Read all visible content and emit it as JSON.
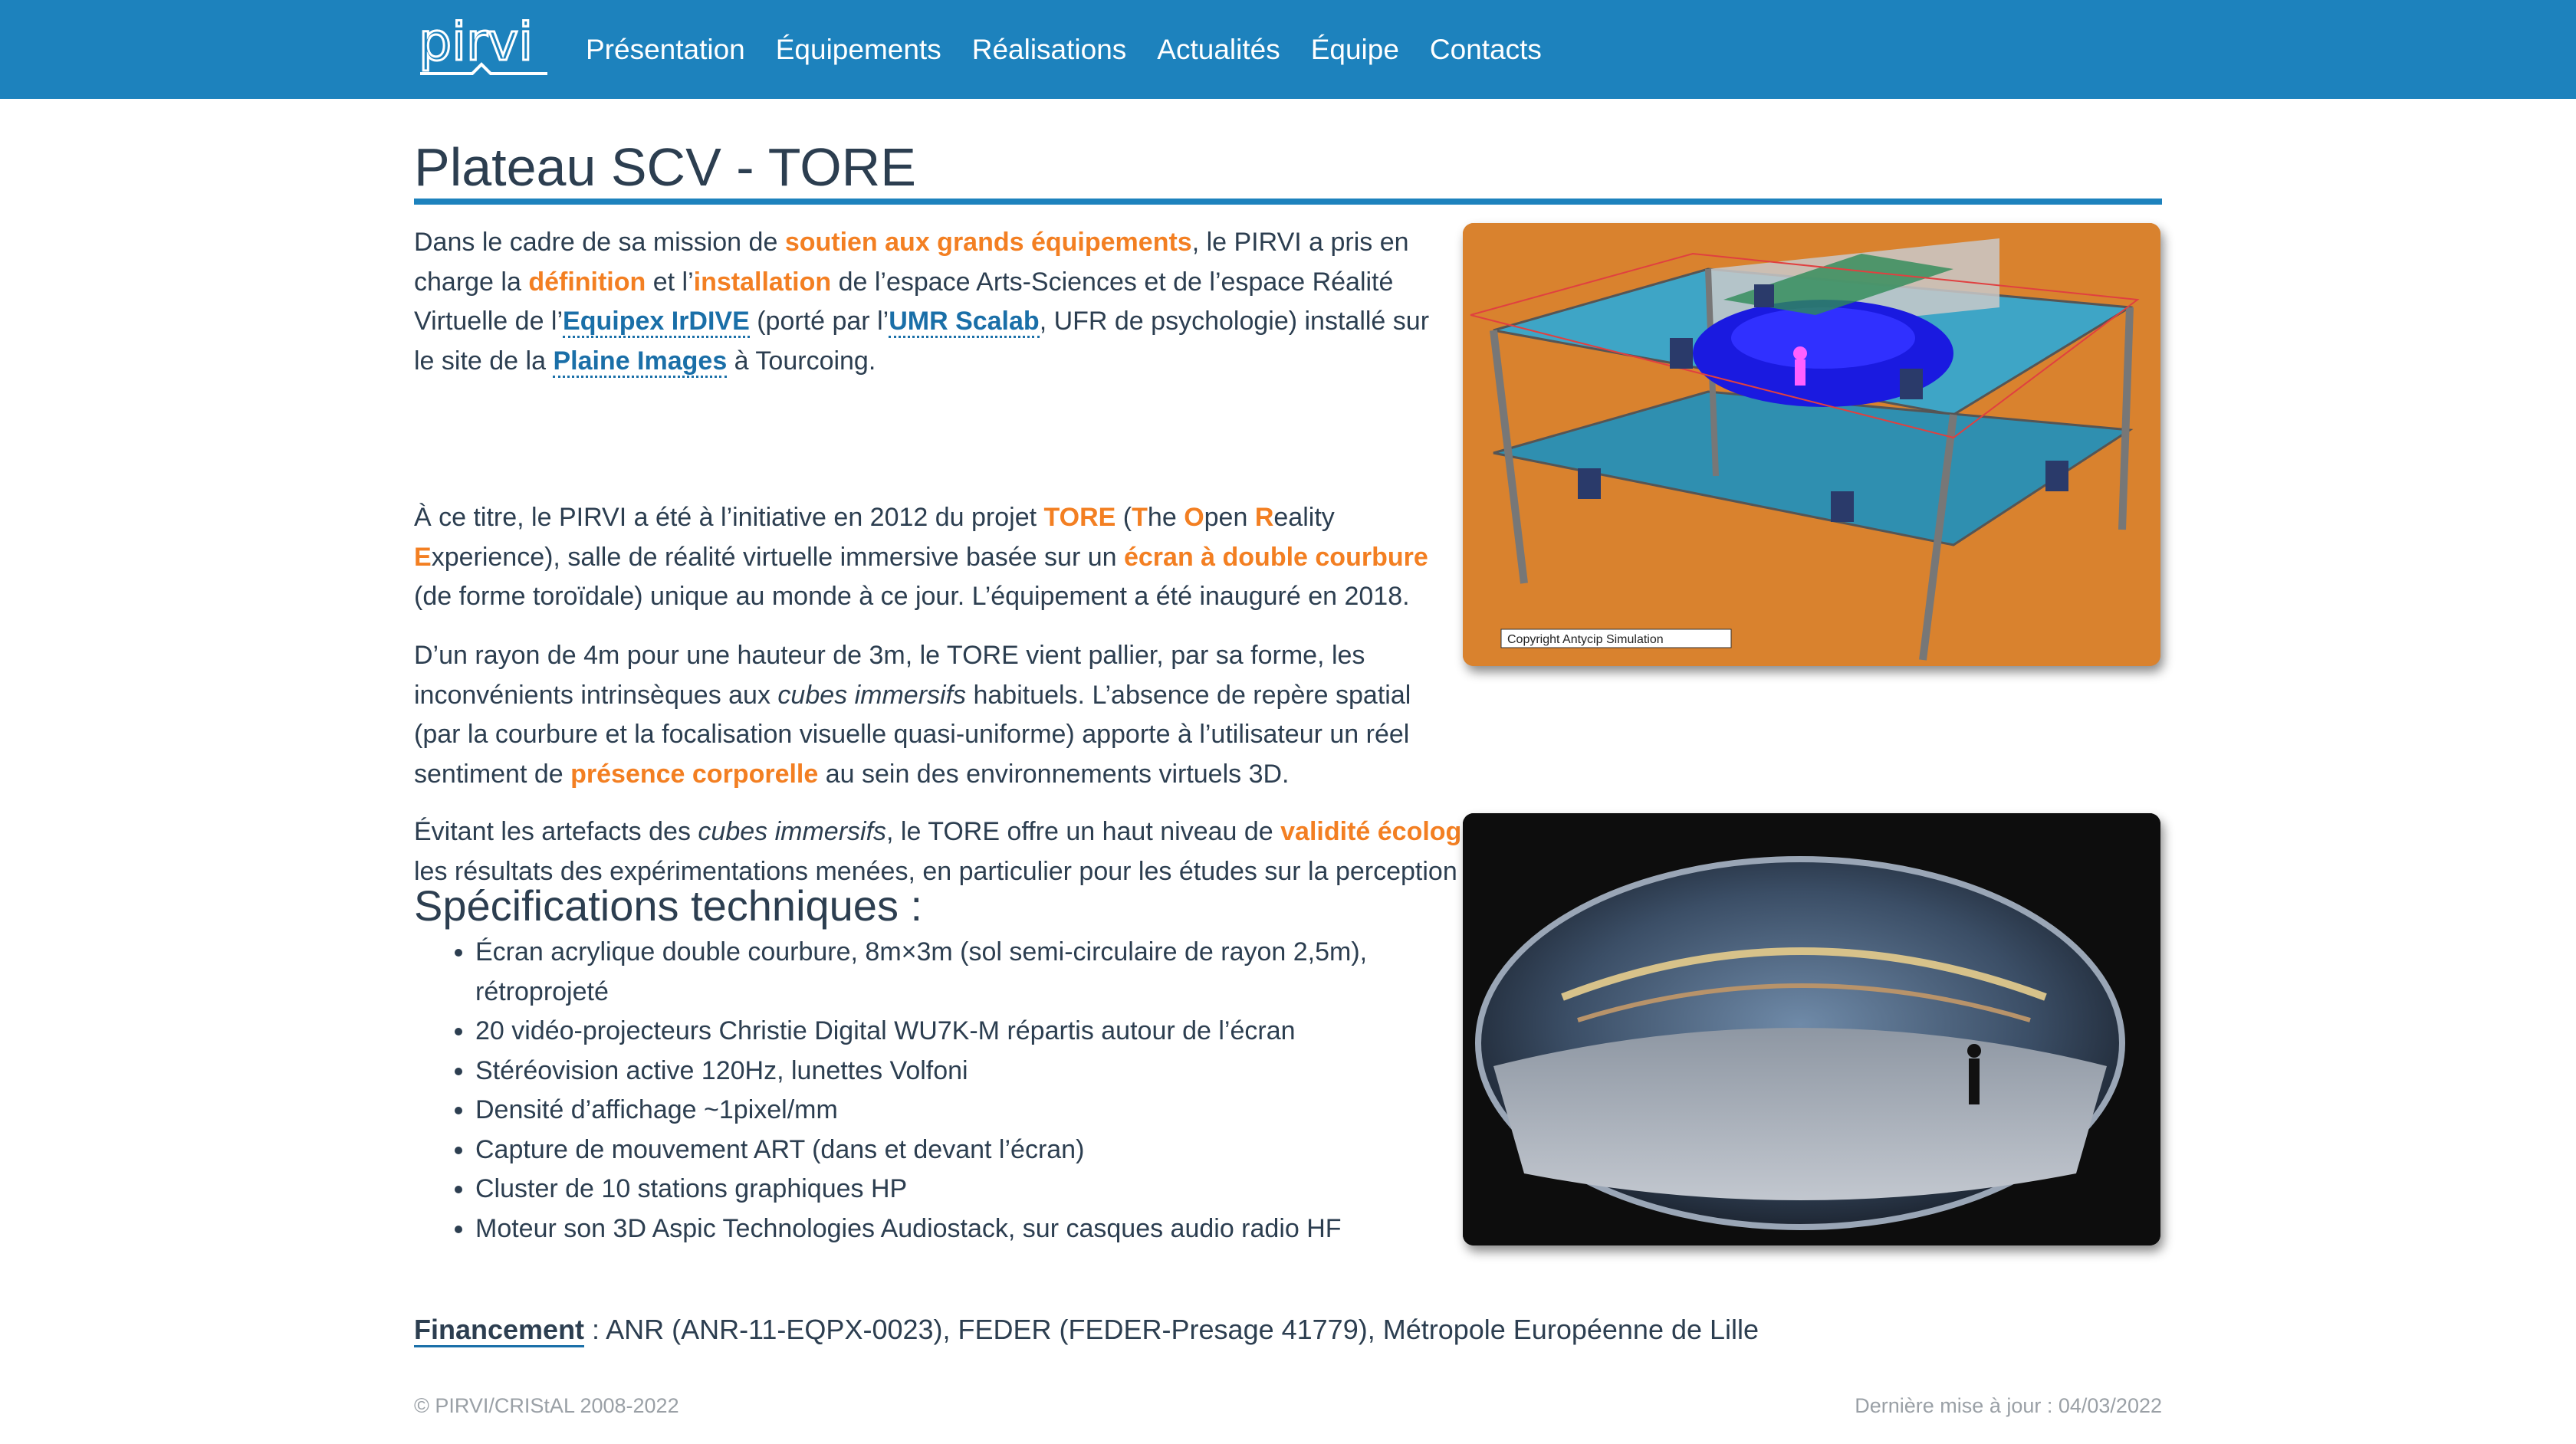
{
  "nav": {
    "logo_text": "pirvi",
    "links": [
      "Présentation",
      "Équipements",
      "Réalisations",
      "Actualités",
      "Équipe",
      "Contacts"
    ]
  },
  "page": {
    "title": "Plateau SCV - TORE",
    "p1": {
      "t1": "Dans le cadre de sa mission de ",
      "h1": "soutien aux grands équipements",
      "t2": ", le PIRVI a pris en charge la ",
      "h2": "définition",
      "t3": " et l’",
      "h3": "installation",
      "t4": " de l’espace Arts-Sciences et de l’espace Réalité Virtuelle de l’",
      "l1": "Equipex IrDIVE",
      "t5": " (porté par l’",
      "l2": "UMR Scalab",
      "t6": ", UFR de psychologie) installé sur le site de la ",
      "l3": "Plaine Images",
      "t7": " à Tourcoing."
    },
    "p2": {
      "t1": "À ce titre, le PIRVI a été à l’initiative en 2012 du projet ",
      "h1": "TORE",
      "t2": " (",
      "L1": "T",
      "w1": "he ",
      "L2": "O",
      "w2": "pen ",
      "L3": "R",
      "w3": "eality ",
      "L4": "E",
      "w4": "xperience), salle de réalité virtuelle immersive basée sur un ",
      "h2": "écran à double courbure",
      "t3": " (de forme toroïdale) unique au monde à ce jour. L’équipement a été inauguré en 2018."
    },
    "p3": {
      "t1": "D’un rayon de 4m pour une hauteur de 3m, le TORE vient pallier, par sa forme, les inconvénients intrinsèques aux ",
      "e1": "cubes immersifs",
      "t2": " habituels. L’absence de repère spatial (par la courbure et la focalisation visuelle quasi-uniforme) apporte à l’utilisateur un réel sentiment de ",
      "h1": "présence corporelle",
      "t3": " au sein des environnements virtuels 3D."
    },
    "p4": {
      "t1": "Évitant les artefacts des ",
      "e1": "cubes immersifs",
      "t2": ", le TORE offre un haut niveau de ",
      "h1": "validité écologique",
      "t3": " des situations simulées virtuellement, améliorant ainsi les résultats des expérimentations menées, en particulier pour les études sur la perception visuelle."
    },
    "image1_caption": "Copyright Antycip Simulation",
    "specs_title": "Spécifications techniques :",
    "specs": [
      "Écran acrylique double courbure, 8m×3m (sol semi-circulaire de rayon 2,5m), rétroprojeté",
      "20 vidéo-projecteurs Christie Digital WU7K-M répartis autour de l’écran",
      "Stéréovision active 120Hz, lunettes Volfoni",
      "Densité d’affichage ~1pixel/mm",
      "Capture de mouvement ART (dans et devant l’écran)",
      "Cluster de 10 stations graphiques HP",
      "Moteur son 3D Aspic Technologies Audiostack, sur casques audio radio HF"
    ],
    "funding_label": "Financement",
    "funding_text": " : ANR (ANR-11-EQPX-0023), FEDER (FEDER-Presage 41779), Métropole Européenne de Lille"
  },
  "footer": {
    "copyright": "© PIRVI/CRIStAL 2008-2022",
    "updated": "Dernière mise à jour : 04/03/2022"
  },
  "colors": {
    "nav_bg": "#1d82bd",
    "accent": "#f37f22",
    "text": "#2c3e50",
    "link": "#1a6fa8"
  }
}
